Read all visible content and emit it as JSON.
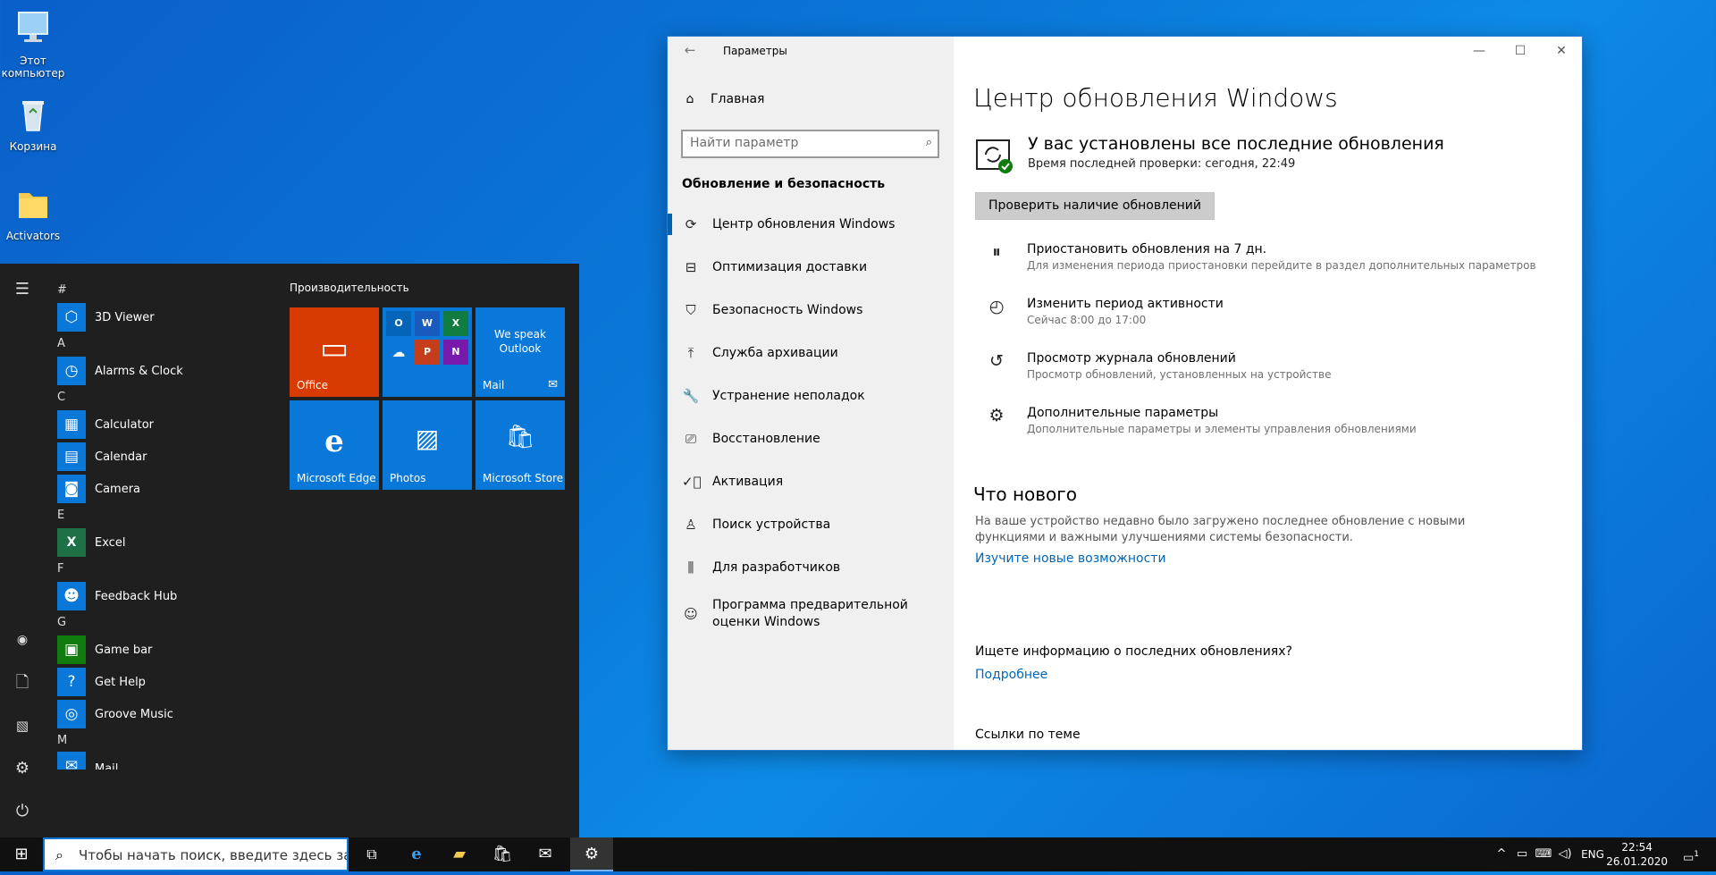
{
  "desktop": {
    "icons": [
      {
        "label": "Этот компьютер",
        "icon": "computer-icon"
      },
      {
        "label": "Корзина",
        "icon": "recycle-bin-icon"
      },
      {
        "label": "Activators",
        "icon": "folder-icon"
      }
    ]
  },
  "start_menu": {
    "apps": [
      {
        "type": "letter",
        "label": "#"
      },
      {
        "type": "app",
        "label": "3D Viewer",
        "icon": "3d-viewer-icon"
      },
      {
        "type": "letter",
        "label": "A"
      },
      {
        "type": "app",
        "label": "Alarms & Clock",
        "icon": "clock-icon"
      },
      {
        "type": "letter",
        "label": "C"
      },
      {
        "type": "app",
        "label": "Calculator",
        "icon": "calculator-icon"
      },
      {
        "type": "app",
        "label": "Calendar",
        "icon": "calendar-icon"
      },
      {
        "type": "app",
        "label": "Camera",
        "icon": "camera-icon"
      },
      {
        "type": "letter",
        "label": "E"
      },
      {
        "type": "app",
        "label": "Excel",
        "icon": "excel-icon"
      },
      {
        "type": "letter",
        "label": "F"
      },
      {
        "type": "app",
        "label": "Feedback Hub",
        "icon": "feedback-hub-icon"
      },
      {
        "type": "letter",
        "label": "G"
      },
      {
        "type": "app",
        "label": "Game bar",
        "icon": "game-bar-icon"
      },
      {
        "type": "app",
        "label": "Get Help",
        "icon": "get-help-icon"
      },
      {
        "type": "app",
        "label": "Groove Music",
        "icon": "groove-music-icon"
      },
      {
        "type": "letter",
        "label": "M"
      },
      {
        "type": "app",
        "label": "Mail",
        "icon": "mail-icon"
      }
    ],
    "tiles_group_title": "Производительность",
    "tiles": {
      "office": "Office",
      "mail_promo": "We speak Outlook",
      "mail": "Mail",
      "edge": "Microsoft Edge",
      "photos": "Photos",
      "store": "Microsoft Store"
    },
    "office_apps": [
      "O",
      "W",
      "X",
      "",
      "P",
      "N"
    ]
  },
  "settings": {
    "window_title": "Параметры",
    "home_label": "Главная",
    "search_placeholder": "Найти параметр",
    "section_header": "Обновление и безопасность",
    "nav_items": [
      {
        "label": "Центр обновления Windows",
        "icon": "sync-icon",
        "active": true
      },
      {
        "label": "Оптимизация доставки",
        "icon": "delivery-icon",
        "active": false
      },
      {
        "label": "Безопасность Windows",
        "icon": "shield-icon",
        "active": false
      },
      {
        "label": "Служба архивации",
        "icon": "backup-icon",
        "active": false
      },
      {
        "label": "Устранение неполадок",
        "icon": "wrench-icon",
        "active": false
      },
      {
        "label": "Восстановление",
        "icon": "recovery-icon",
        "active": false
      },
      {
        "label": "Активация",
        "icon": "activation-icon",
        "active": false
      },
      {
        "label": "Поиск устройства",
        "icon": "find-device-icon",
        "active": false
      },
      {
        "label": "Для разработчиков",
        "icon": "developer-icon",
        "active": false
      },
      {
        "label": "Программа предварительной оценки Windows",
        "icon": "insider-icon",
        "active": false
      }
    ],
    "page_title": "Центр обновления Windows",
    "status_heading": "У вас установлены все последние обновления",
    "status_sub": "Время последней проверки: сегодня, 22:49",
    "check_button": "Проверить наличие обновлений",
    "options": [
      {
        "title": "Приостановить обновления на 7 дн.",
        "sub": "Для изменения периода приостановки перейдите в раздел дополнительных параметров",
        "icon": "pause-icon"
      },
      {
        "title": "Изменить период активности",
        "sub": "Сейчас 8:00 до 17:00",
        "icon": "active-hours-icon"
      },
      {
        "title": "Просмотр журнала обновлений",
        "sub": "Просмотр обновлений, установленных на устройстве",
        "icon": "history-icon"
      },
      {
        "title": "Дополнительные параметры",
        "sub": "Дополнительные параметры и элементы управления обновлениями",
        "icon": "advanced-options-icon"
      }
    ],
    "whats_new_heading": "Что нового",
    "whats_new_text": "На ваше устройство недавно было загружено последнее обновление с новыми функциями и важными улучшениями системы безопасности.",
    "whats_new_link": "Изучите новые возможности",
    "info_question": "Ищете информацию о последних обновлениях?",
    "info_link": "Подробнее",
    "related_heading": "Ссылки по теме"
  },
  "taskbar": {
    "search_placeholder": "Чтобы начать поиск, введите здесь запрос",
    "language": "ENG",
    "time": "22:54",
    "date": "26.01.2020",
    "notification_count": "1"
  },
  "colors": {
    "accent": "#0063b1",
    "link": "#0067b8",
    "office_tile": "#d83b01",
    "tile_blue": "#0a78d8"
  }
}
